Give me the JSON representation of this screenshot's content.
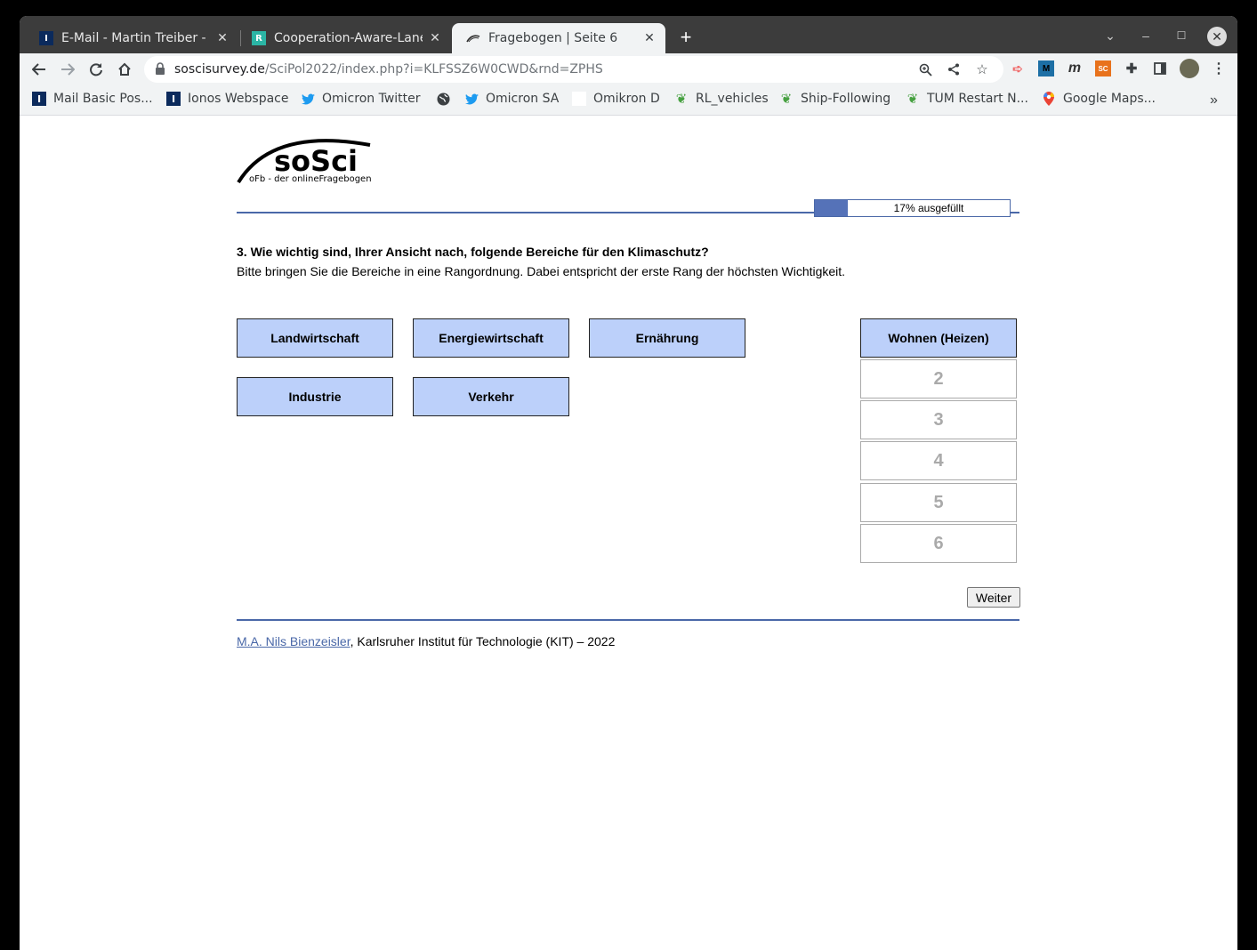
{
  "browser": {
    "tabs": [
      {
        "title": "E-Mail - Martin Treiber - M",
        "favicon": "I"
      },
      {
        "title": "Cooperation-Aware-Lane",
        "favicon": "R"
      },
      {
        "title": "Fragebogen | Seite 6",
        "favicon": "sosci-swoosh"
      }
    ],
    "url_host": "soscisurvey.de",
    "url_path": "/SciPol2022/index.php?i=KLFSSZ6W0CWD&rnd=ZPHS",
    "bookmarks": [
      {
        "label": "Mail Basic Pos...",
        "icon": "I"
      },
      {
        "label": "Ionos Webspace",
        "icon": "I"
      },
      {
        "label": "Omicron Twitter",
        "icon": "twitter-icon"
      },
      {
        "label": "",
        "icon": "globe-icon"
      },
      {
        "label": "Omicron SA",
        "icon": "twitter-icon"
      },
      {
        "label": "Omikron D",
        "icon": "blank"
      },
      {
        "label": "RL_vehicles",
        "icon": "overleaf-icon"
      },
      {
        "label": "Ship-Following",
        "icon": "overleaf-icon"
      },
      {
        "label": "TUM Restart N...",
        "icon": "overleaf-icon"
      },
      {
        "label": "Google Maps...",
        "icon": "maps-icon"
      }
    ],
    "bookmarks_more": "»",
    "extensions": [
      "M",
      "m",
      "SC"
    ]
  },
  "survey": {
    "logo_text": "soSci",
    "logo_sub": "oFb - der onlineFragebogen",
    "progress_label": "17% ausgefüllt",
    "progress_fraction": 0.17,
    "question_title": "3. Wie wichtig sind, Ihrer Ansicht nach, folgende Bereiche für den Klimaschutz?",
    "question_hint": "Bitte bringen Sie die Bereiche in eine Rangordnung. Dabei entspricht der erste Rang der höchsten Wichtigkeit.",
    "items": [
      "Landwirtschaft",
      "Energiewirtschaft",
      "Ernährung",
      "Industrie",
      "Verkehr"
    ],
    "ranked": [
      "Wohnen (Heizen)"
    ],
    "empty_slots": [
      "2",
      "3",
      "4",
      "5",
      "6"
    ],
    "next_button": "Weiter",
    "footer_author": "M.A. Nils Bienzeisler",
    "footer_rest": ", Karlsruher Institut für Technologie (KIT) – 2022"
  }
}
